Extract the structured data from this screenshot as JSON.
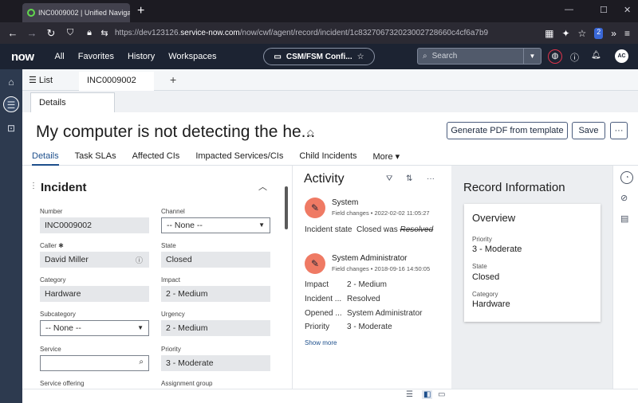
{
  "browser": {
    "tab_title": "INC0009002 | Unified Navigati",
    "close": "✕",
    "new_tab": "+",
    "win_min": "—",
    "win_max": "☐",
    "win_close": "✕",
    "url_prefix": "https://dev123126.",
    "url_domain": "service-now.com",
    "url_rest": "/now/cwf/agent/record/incident/1c832706732023002728660c4cf6a7b9",
    "extension_badge": "2"
  },
  "sn_header": {
    "logo": "now",
    "menus": [
      "All",
      "Favorites",
      "History",
      "Workspaces"
    ],
    "workspace_pill": "CSM/FSM Confi...",
    "search_placeholder": "Search",
    "avatar_initials": "AC"
  },
  "workspace_tabs": {
    "list_label": "List",
    "record_tab": "INC0009002",
    "add": "+"
  },
  "sub_tab": "Details",
  "record": {
    "title": "My computer is not detecting the he...",
    "buttons": {
      "generate_pdf": "Generate PDF from template",
      "save": "Save",
      "more": "···"
    }
  },
  "form_tabs": [
    "Details",
    "Task SLAs",
    "Affected CIs",
    "Impacted Services/CIs",
    "Child Incidents",
    "More ▾"
  ],
  "form": {
    "section_title": "Incident",
    "fields": {
      "number_label": "Number",
      "number_value": "INC0009002",
      "channel_label": "Channel",
      "channel_value": "-- None --",
      "caller_label": "Caller ✱",
      "caller_value": "David Miller",
      "state_label": "State",
      "state_value": "Closed",
      "category_label": "Category",
      "category_value": "Hardware",
      "impact_label": "Impact",
      "impact_value": "2 - Medium",
      "subcategory_label": "Subcategory",
      "subcategory_value": "-- None --",
      "urgency_label": "Urgency",
      "urgency_value": "2 - Medium",
      "service_label": "Service",
      "service_value": "",
      "priority_label": "Priority",
      "priority_value": "3 - Moderate",
      "service_offering_label": "Service offering",
      "assignment_group_label": "Assignment group"
    }
  },
  "activity": {
    "title": "Activity",
    "entries": [
      {
        "author": "System",
        "meta": "Field changes • 2022-02-02 11:05:27",
        "rows": [
          {
            "key": "Incident state",
            "value": "Closed was",
            "was": "Resolved"
          }
        ]
      },
      {
        "author": "System Administrator",
        "meta": "Field changes • 2018-09-16 14:50:05",
        "rows": [
          {
            "key": "Impact",
            "value": "2 - Medium"
          },
          {
            "key": "Incident ...",
            "value": "Resolved"
          },
          {
            "key": "Opened ...",
            "value": "System Administrator"
          },
          {
            "key": "Priority",
            "value": "3 - Moderate"
          }
        ]
      }
    ],
    "show_more": "Show more"
  },
  "record_info": {
    "title": "Record Information",
    "overview_title": "Overview",
    "priority_label": "Priority",
    "priority_value": "3 - Moderate",
    "state_label": "State",
    "state_value": "Closed",
    "category_label": "Category",
    "category_value": "Hardware"
  },
  "colors": {
    "accent": "#1d4f8c",
    "header_bg": "#1c2332",
    "rail_bg": "#2d3a4f",
    "activity_avatar": "#ef7a64"
  }
}
